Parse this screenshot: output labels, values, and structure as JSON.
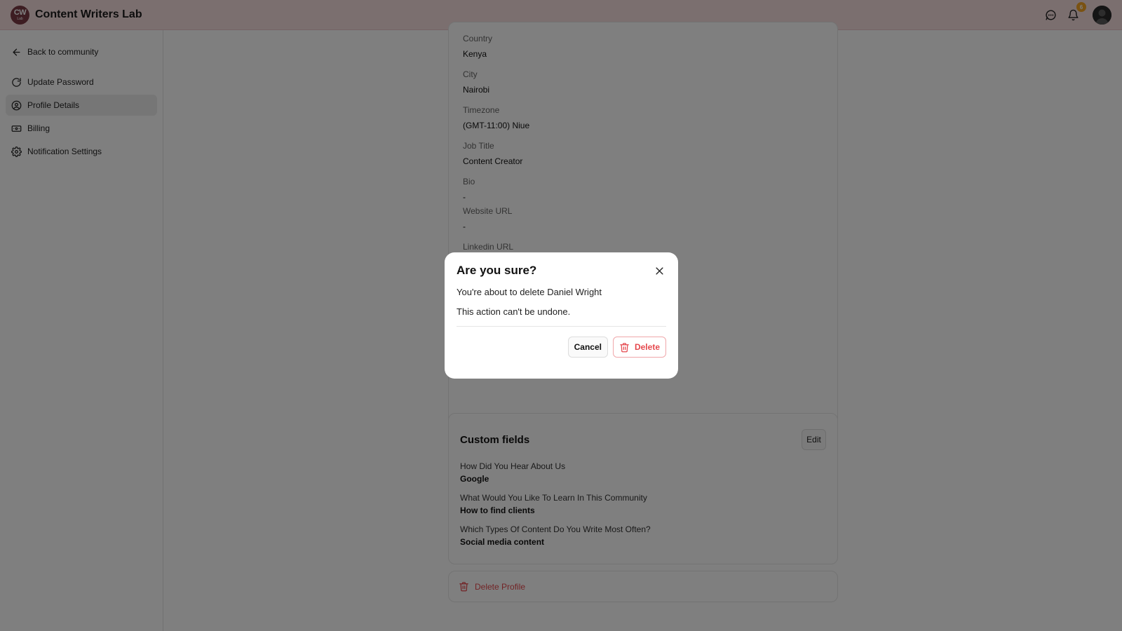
{
  "header": {
    "logo_main": "CW",
    "logo_sub": "Lab",
    "brand": "Content Writers Lab",
    "notification_count": "6",
    "icons": [
      "chat-icon",
      "bell-icon",
      "avatar"
    ]
  },
  "sidebar": {
    "back_label": "Back to community",
    "items": [
      {
        "label": "Update Password",
        "icon": "refresh-icon"
      },
      {
        "label": "Profile Details",
        "icon": "user-circle-icon",
        "active": true
      },
      {
        "label": "Billing",
        "icon": "billing-icon"
      },
      {
        "label": "Notification Settings",
        "icon": "gear-icon"
      }
    ]
  },
  "profile": {
    "fields": [
      {
        "label": "Country",
        "value": "Kenya"
      },
      {
        "label": "City",
        "value": "Nairobi"
      },
      {
        "label": "Timezone",
        "value": "(GMT-11:00) Niue"
      },
      {
        "label": "Job Title",
        "value": "Content Creator"
      },
      {
        "label": "Bio",
        "value": "-"
      },
      {
        "label": "Website URL",
        "value": "-"
      },
      {
        "label": "Linkedin URL",
        "value": ""
      }
    ]
  },
  "custom_fields": {
    "title": "Custom fields",
    "edit_label": "Edit",
    "items": [
      {
        "question": "How Did You Hear About Us",
        "answer": "Google"
      },
      {
        "question": "What Would You Like To Learn In This Community",
        "answer": "How to find clients"
      },
      {
        "question": "Which Types Of Content Do You Write Most Often?",
        "answer": "Social media content"
      }
    ]
  },
  "delete_profile": {
    "label": "Delete Profile"
  },
  "modal": {
    "title": "Are you sure?",
    "line1": "You're about to delete Daniel Wright",
    "line2": "This action can't be undone.",
    "cancel_label": "Cancel",
    "delete_label": "Delete"
  },
  "colors": {
    "topbar": "#f7dedf",
    "danger": "#e5484d",
    "badge": "#f5a524"
  }
}
